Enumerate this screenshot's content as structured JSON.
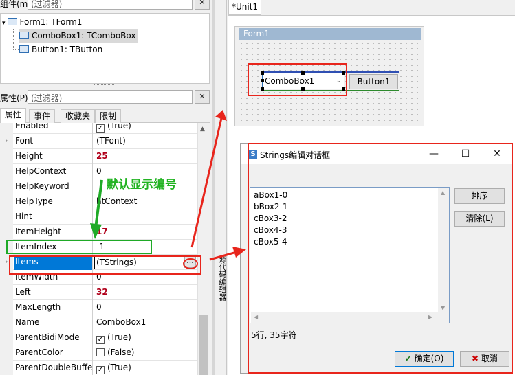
{
  "inspector": {
    "top_filter": {
      "label": "组件(m)",
      "placeholder": "(过滤器)"
    },
    "tree": [
      {
        "label": "Form1: TForm1"
      },
      {
        "label": "ComboBox1: TComboBox"
      },
      {
        "label": "Button1: TButton"
      }
    ],
    "prop_filter": {
      "label": "属性(P)",
      "placeholder": "(过滤器)"
    },
    "tabs": [
      "属性",
      "事件",
      "收藏夹",
      "限制"
    ],
    "properties": [
      {
        "name": "Enabled",
        "value": "(True)",
        "check": "✓"
      },
      {
        "name": "Font",
        "value": "(TFont)",
        "expander": "›"
      },
      {
        "name": "Height",
        "value": "25",
        "bold": true
      },
      {
        "name": "HelpContext",
        "value": "0"
      },
      {
        "name": "HelpKeyword",
        "value": ""
      },
      {
        "name": "HelpType",
        "value": "htContext"
      },
      {
        "name": "Hint",
        "value": ""
      },
      {
        "name": "ItemHeight",
        "value": "17",
        "bold": true
      },
      {
        "name": "ItemIndex",
        "value": "-1"
      },
      {
        "name": "Items",
        "value": "(TStrings)",
        "selected": true,
        "expander": "›"
      },
      {
        "name": "ItemWidth",
        "value": "0"
      },
      {
        "name": "Left",
        "value": "32",
        "bold": true
      },
      {
        "name": "MaxLength",
        "value": "0"
      },
      {
        "name": "Name",
        "value": "ComboBox1"
      },
      {
        "name": "ParentBidiMode",
        "value": "(True)",
        "check": "✓"
      },
      {
        "name": "ParentColor",
        "value": "(False)",
        "check": " "
      },
      {
        "name": "ParentDoubleBuffered",
        "value": "(True)",
        "check": "✓"
      }
    ],
    "ellipsis": "..."
  },
  "side_tab": "源代码编辑器",
  "designer": {
    "doc_tab": "*Unit1",
    "form_title": "Form1",
    "combo_text": "ComboBox1",
    "button_text": "Button1"
  },
  "dialog": {
    "title": "Strings编辑对话框",
    "lines": [
      "aBox1-0",
      "bBox2-1",
      "cBox3-2",
      "cBox4-3",
      "cBox5-4"
    ],
    "sort_button": "排序",
    "clear_button": "清除(L)",
    "status": "5行, 35字符",
    "ok_button": "确定(O)",
    "cancel_button": "取消"
  },
  "annotation": {
    "text": "默认显示编号",
    "colors": {
      "red": "#e8251c",
      "green": "#1faa27"
    }
  }
}
